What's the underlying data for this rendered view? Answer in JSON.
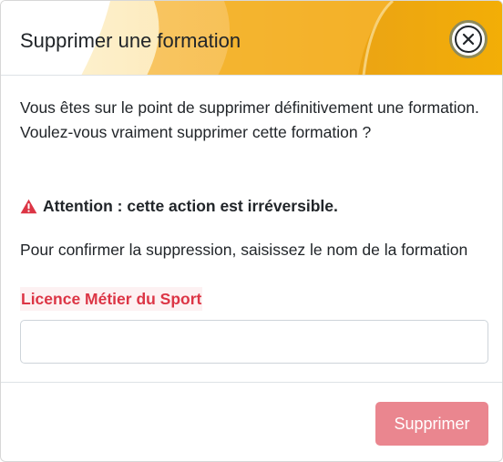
{
  "modal": {
    "title": "Supprimer une formation",
    "close_icon": "close-icon",
    "header_colors": {
      "light": "#fde9b4",
      "mid": "#f6bc4a",
      "accent": "#f1ab05",
      "dark": "#e39c00"
    }
  },
  "body": {
    "intro_line1": "Vous êtes sur le point de supprimer définitivement une formation.",
    "intro_line2": "Voulez-vous vraiment supprimer cette formation ?",
    "warning_icon": "warning-triangle-icon",
    "warning_text": "Attention : cette action est irréversible.",
    "confirm_instruction": "Pour confirmer la suppression, saisissez le nom de la formation",
    "course_name": "Licence Métier du Sport",
    "input_value": "",
    "input_placeholder": ""
  },
  "footer": {
    "delete_label": "Supprimer",
    "delete_color": "#ea868f"
  }
}
